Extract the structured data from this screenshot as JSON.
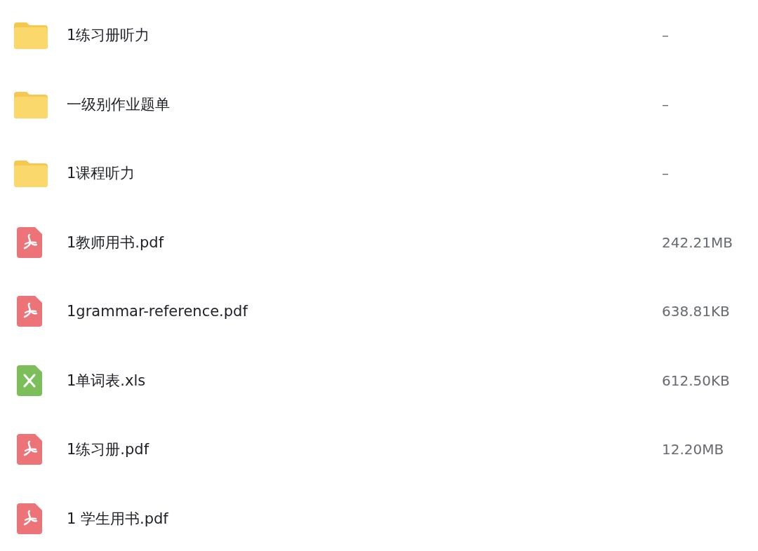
{
  "files": [
    {
      "kind": "folder",
      "name": "1练习册听力",
      "size": "–"
    },
    {
      "kind": "folder",
      "name": "一级别作业题单",
      "size": "–"
    },
    {
      "kind": "folder",
      "name": "1课程听力",
      "size": "–"
    },
    {
      "kind": "pdf",
      "name": "1教师用书.pdf",
      "size": "242.21MB"
    },
    {
      "kind": "pdf",
      "name": "1grammar-reference.pdf",
      "size": "638.81KB"
    },
    {
      "kind": "xls",
      "name": "1单词表.xls",
      "size": "612.50KB"
    },
    {
      "kind": "pdf",
      "name": "1练习册.pdf",
      "size": "12.20MB"
    },
    {
      "kind": "pdf",
      "name": "1 学生用书.pdf"
    }
  ]
}
